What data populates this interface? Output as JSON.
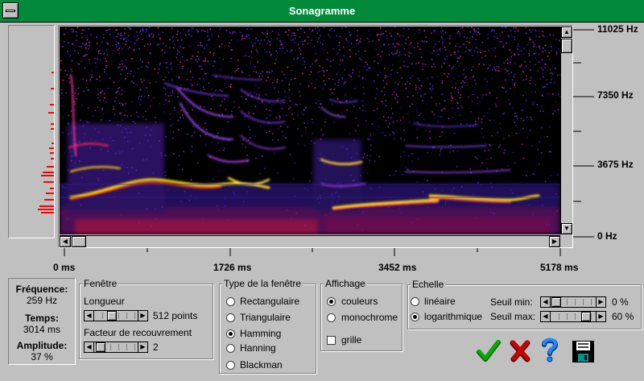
{
  "window": {
    "title": "Sonagramme"
  },
  "freq_axis": [
    "11025 Hz",
    "7350 Hz",
    "3675 Hz",
    "0 Hz"
  ],
  "time_axis": [
    "0 ms",
    "1726 ms",
    "3452 ms",
    "5178 ms"
  ],
  "info": {
    "freq_label": "Fréquence:",
    "freq_value": "259 Hz",
    "time_label": "Temps:",
    "time_value": "3014 ms",
    "amp_label": "Amplitude:",
    "amp_value": "37 %"
  },
  "fenetre": {
    "title": "Fenêtre",
    "length_label": "Longueur",
    "length_value": "512 points",
    "overlap_label": "Facteur de recouvrement",
    "overlap_value": "2"
  },
  "window_type": {
    "title": "Type de la fenêtre",
    "options": [
      "Rectangulaire",
      "Triangulaire",
      "Hamming",
      "Hanning",
      "Blackman"
    ],
    "selected": "Hamming"
  },
  "affichage": {
    "title": "Affichage",
    "options": [
      "couleurs",
      "monochrome"
    ],
    "selected": "couleurs",
    "grid_label": "grille",
    "grid_checked": false
  },
  "echelle": {
    "title": "Echelle",
    "options": [
      "linéaire",
      "logarithmique"
    ],
    "selected": "logarithmique",
    "seuil_min_label": "Seuil min:",
    "seuil_min_value": "0 %",
    "seuil_max_label": "Seuil max:",
    "seuil_max_value": "60 %"
  },
  "colors": {
    "title_bar": "#008a3a",
    "spectrum_bg": "#000000",
    "ok": "#00a000",
    "cancel": "#c00000",
    "help": "#0070ff"
  },
  "icons": [
    "ok-check-icon",
    "cancel-x-icon",
    "help-question-icon",
    "save-disk-icon"
  ]
}
